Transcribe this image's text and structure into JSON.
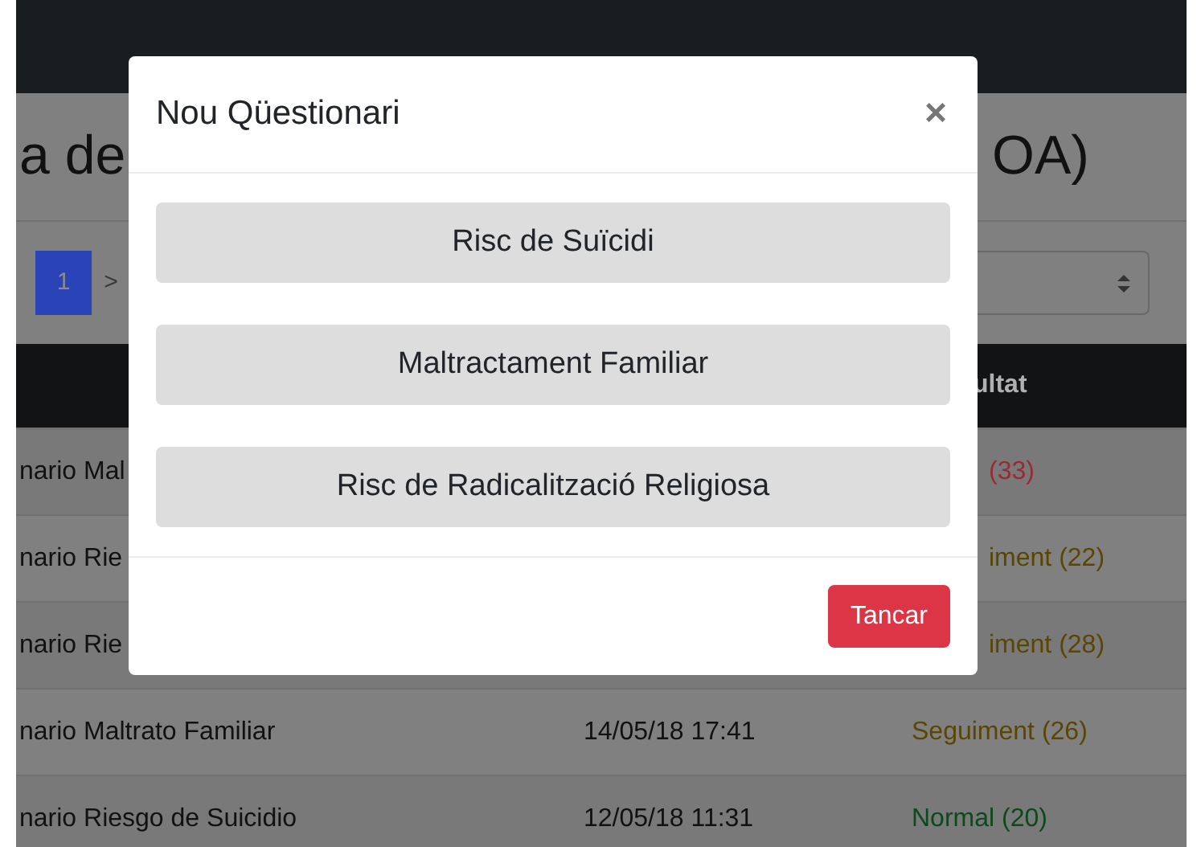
{
  "page": {
    "title_left": "a de",
    "title_right": "OA)"
  },
  "pagination": [
    {
      "label": "1",
      "selected": true
    },
    {
      "label": ">",
      "selected": false
    }
  ],
  "table": {
    "header_result": "ultat",
    "rows": [
      {
        "name": "nario Mal",
        "result": "(33)",
        "color": "#9a2a35"
      },
      {
        "name": "nario Rie",
        "result": "iment (22)",
        "color": "#5a4600"
      },
      {
        "name": "nario Rie",
        "result": "iment (28)",
        "color": "#5a4600"
      },
      {
        "name": "nario Maltrato Familiar",
        "date": "14/05/18 17:41",
        "result": "Seguiment (26)",
        "color": "#5a4600"
      },
      {
        "name": "nario Riesgo de Suicidio",
        "date": "12/05/18 11:31",
        "result": "Normal (20)",
        "color": "#0c4a1c"
      }
    ]
  },
  "modal": {
    "title": "Nou Qüestionari",
    "close": "×",
    "options": [
      "Risc de Suïcidi",
      "Maltractament Familiar",
      "Risc de Radicalització Religiosa"
    ],
    "footer_button": "Tancar"
  }
}
